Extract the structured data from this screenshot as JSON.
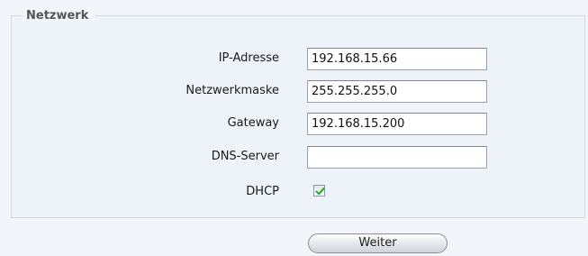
{
  "fieldset": {
    "legend": "Netzwerk"
  },
  "form": {
    "ip": {
      "label": "IP-Adresse",
      "value": "192.168.15.66"
    },
    "netmask": {
      "label": "Netzwerkmaske",
      "value": "255.255.255.0"
    },
    "gateway": {
      "label": "Gateway",
      "value": "192.168.15.200"
    },
    "dns": {
      "label": "DNS-Server",
      "value": ""
    },
    "dhcp": {
      "label": "DHCP",
      "checked": true,
      "check_color": "#2aa52a"
    }
  },
  "actions": {
    "next_label": "Weiter"
  }
}
